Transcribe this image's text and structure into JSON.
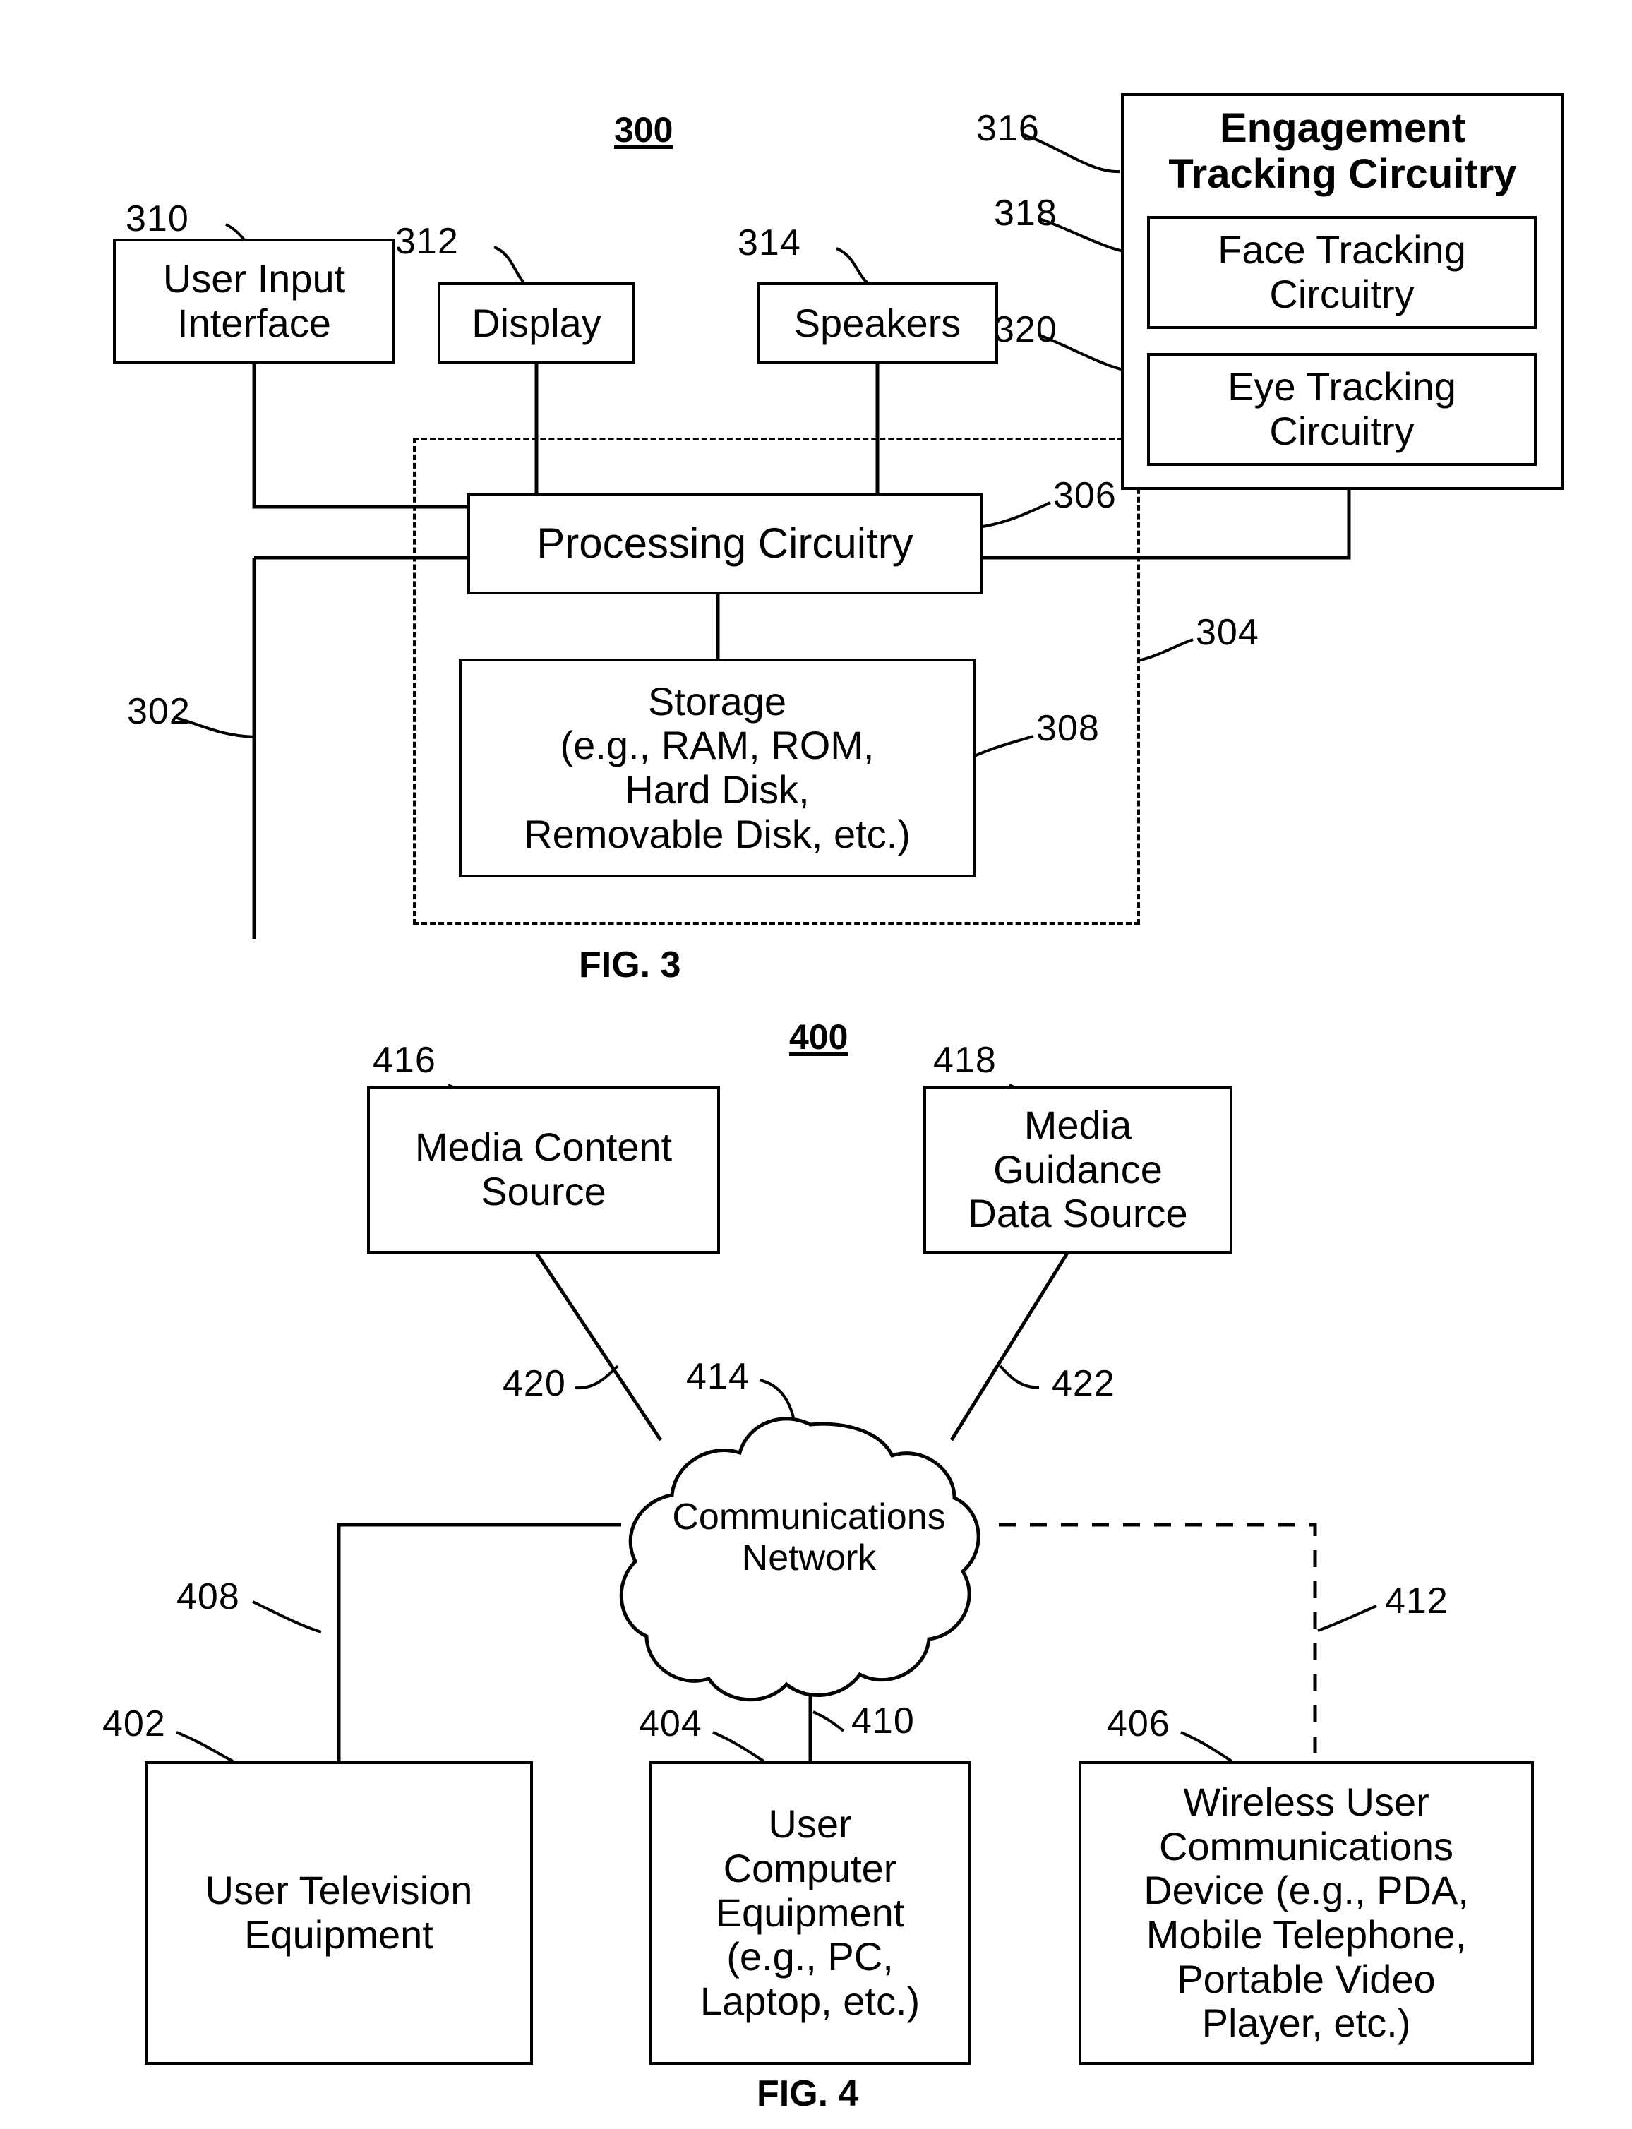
{
  "figures": [
    {
      "id": "fig3",
      "figure_number": "300",
      "caption": "FIG. 3",
      "boxes": [
        {
          "ref": "310",
          "label": "User Input\nInterface"
        },
        {
          "ref": "312",
          "label": "Display"
        },
        {
          "ref": "314",
          "label": "Speakers"
        },
        {
          "ref": "316",
          "label": "Engagement\nTracking Circuitry"
        },
        {
          "ref": "318",
          "label": "Face Tracking\nCircuitry"
        },
        {
          "ref": "320",
          "label": "Eye Tracking\nCircuitry"
        },
        {
          "ref": "306",
          "label": "Processing Circuitry"
        },
        {
          "ref": "308",
          "label": "Storage\n(e.g., RAM, ROM,\nHard Disk,\nRemovable Disk, etc.)"
        },
        {
          "ref": "304",
          "label": ""
        },
        {
          "ref": "302",
          "label": ""
        }
      ],
      "labels": {
        "user_input_interface": "User Input\nInterface",
        "display": "Display",
        "speakers": "Speakers",
        "engagement_tracking_circuitry": "Engagement\nTracking Circuitry",
        "face_tracking_circuitry": "Face Tracking\nCircuitry",
        "eye_tracking_circuitry": "Eye Tracking\nCircuitry",
        "processing_circuitry": "Processing Circuitry",
        "storage": "Storage\n(e.g., RAM, ROM,\nHard Disk,\nRemovable Disk, etc.)"
      },
      "numerals": {
        "n310": "310",
        "n312": "312",
        "n314": "314",
        "n316": "316",
        "n318": "318",
        "n320": "320",
        "n306": "306",
        "n308": "308",
        "n304": "304",
        "n302": "302"
      }
    },
    {
      "id": "fig4",
      "figure_number": "400",
      "caption": "FIG. 4",
      "labels": {
        "media_content_source": "Media Content\nSource",
        "media_guidance_data_source": "Media\nGuidance\nData Source",
        "communications_network": "Communications\nNetwork",
        "user_television_equipment": "User Television\nEquipment",
        "user_computer_equipment": "User\nComputer\nEquipment\n(e.g., PC,\nLaptop, etc.)",
        "wireless_user_communications_device": "Wireless User\nCommunications\nDevice (e.g., PDA,\nMobile Telephone,\nPortable Video\nPlayer, etc.)"
      },
      "numerals": {
        "n416": "416",
        "n418": "418",
        "n420": "420",
        "n414": "414",
        "n422": "422",
        "n408": "408",
        "n410": "410",
        "n412": "412",
        "n402": "402",
        "n404": "404",
        "n406": "406"
      }
    }
  ],
  "colors": {
    "ink": "#000000",
    "paper": "#ffffff"
  }
}
